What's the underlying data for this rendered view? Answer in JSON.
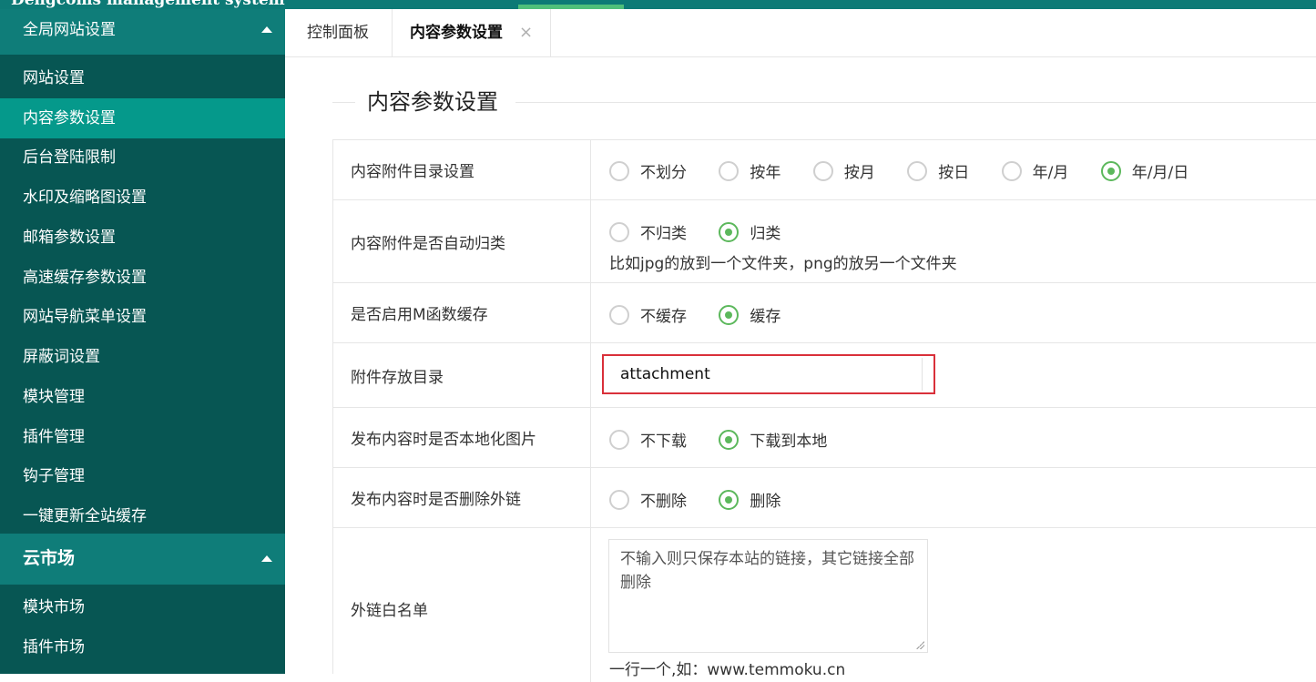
{
  "app": {
    "brand": "Dengcoms management system"
  },
  "sidebar": {
    "group1": {
      "title": "全局网站设置"
    },
    "items": [
      {
        "label": "网站设置"
      },
      {
        "label": "内容参数设置"
      },
      {
        "label": "后台登陆限制"
      },
      {
        "label": "水印及缩略图设置"
      },
      {
        "label": "邮箱参数设置"
      },
      {
        "label": "高速缓存参数设置"
      },
      {
        "label": "网站导航菜单设置"
      },
      {
        "label": "屏蔽词设置"
      },
      {
        "label": "模块管理"
      },
      {
        "label": "插件管理"
      },
      {
        "label": "钩子管理"
      },
      {
        "label": "一键更新全站缓存"
      }
    ],
    "group2": {
      "title": "云市场"
    },
    "items2": [
      {
        "label": "模块市场"
      },
      {
        "label": "插件市场"
      }
    ]
  },
  "tabs": [
    {
      "label": "控制面板"
    },
    {
      "label": "内容参数设置",
      "close": "×"
    }
  ],
  "main": {
    "legend": "内容参数设置",
    "rows": {
      "attach_dir": {
        "label": "内容附件目录设置",
        "options": [
          "不划分",
          "按年",
          "按月",
          "按日",
          "年/月",
          "年/月/日"
        ],
        "selected": "年/月/日"
      },
      "auto_classify": {
        "label": "内容附件是否自动归类",
        "options": [
          "不归类",
          "归类"
        ],
        "selected": "归类",
        "hint": "比如jpg的放到一个文件夹，png的放另一个文件夹"
      },
      "m_cache": {
        "label": "是否启用M函数缓存",
        "options": [
          "不缓存",
          "缓存"
        ],
        "selected": "缓存"
      },
      "storage_dir": {
        "label": "附件存放目录",
        "value": "attachment"
      },
      "localize_images": {
        "label": "发布内容时是否本地化图片",
        "options": [
          "不下载",
          "下载到本地"
        ],
        "selected": "下载到本地"
      },
      "remove_links": {
        "label": "发布内容时是否删除外链",
        "options": [
          "不删除",
          "删除"
        ],
        "selected": "删除"
      },
      "whitelist": {
        "label": "外链白名单",
        "placeholder": "不输入则只保存本站的链接，其它链接全部删除",
        "hint": "一行一个,如：www.temmoku.cn"
      }
    }
  },
  "colors": {
    "sidebar_bg": "#075653",
    "group_bg": "#0f7d79",
    "active_bg": "#05998b",
    "radio_checked": "#5cb85c",
    "focus_border": "#d9303a"
  }
}
